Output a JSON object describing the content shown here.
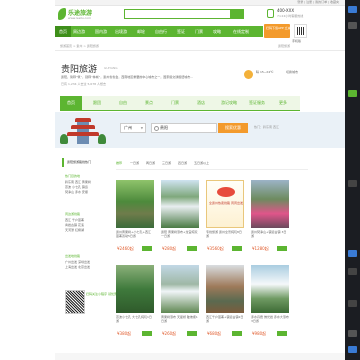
{
  "topbar": {
    "links": "登录 | 注册 | 我的订单 | 收藏夹"
  },
  "header": {
    "logo_text": "乐途旅游",
    "logo_sub": "www.leetu.com",
    "phone": "400-XXX",
    "phone_sub": "7×24小时客服热线",
    "app_promo": "扫码下载APP 立减50元",
    "qr_label": "手机版"
  },
  "nav": {
    "items": [
      {
        "label": "首页"
      },
      {
        "label": "周边游"
      },
      {
        "label": "国内游"
      },
      {
        "label": "出境游"
      },
      {
        "label": "邮轮"
      },
      {
        "label": "自由行"
      },
      {
        "label": "签证"
      },
      {
        "label": "门票"
      },
      {
        "label": "攻略"
      },
      {
        "label": "在线定制"
      }
    ]
  },
  "breadcrumb": "旅游首页 > 贵州 > 贵阳旅游",
  "breadcrumb_right": "贵阳旅游",
  "destination": {
    "title": "贵阳旅游",
    "pinyin": "GUIYANG",
    "description": "贵阳，简称“筑”，别称“林城”，贵州省省会，西南地区重要的中心城市之一，国家级交通枢纽城市...",
    "stats": "已有 1,234 人去过   5,678 人想去",
    "weather": "晴 15~24℃",
    "country": "切换城市"
  },
  "dtabs": [
    {
      "label": "首页"
    },
    {
      "label": "跟团"
    },
    {
      "label": "自由"
    },
    {
      "label": "景点"
    },
    {
      "label": "门票"
    },
    {
      "label": "酒店"
    },
    {
      "label": "游记攻略"
    },
    {
      "label": "签证服务"
    },
    {
      "label": "更多"
    }
  ],
  "search": {
    "from_value": "广州",
    "input_value": "贵阳",
    "button": "搜索优惠",
    "hot": "热门：黔东南  西江"
  },
  "left_panel": {
    "title": "贵阳旅游路线热门",
    "sections": [
      {
        "heading": "热门目的地",
        "lines": [
          "黔东南 西江 黄果树",
          "荔波 小七孔 镇远",
          "梵净山 赤水 安顺"
        ]
      },
      {
        "heading": "周边游线路",
        "lines": [
          "西江 千户苗寨",
          "青岩古镇 花溪",
          "天河潭 红枫湖"
        ]
      },
      {
        "heading": "出发地线路",
        "lines": [
          "广州出发 深圳出发",
          "上海出发 北京出发"
        ]
      }
    ],
    "qr_text": "扫码关注小程序\n领优惠立减50元"
  },
  "filters": [
    "推荐",
    "一日游",
    "两日游",
    "三日游",
    "四日游",
    "五日游以上"
  ],
  "cards": [
    {
      "caption": "贵州黄果树+小七孔+西江苗寨双动5日游",
      "price": "¥2460起"
    },
    {
      "caption": "贵阳 黄果树瀑布+龙宫纯玩一日游",
      "price": "¥280起"
    },
    {
      "caption": "专线旅游 贵州全景纯玩8日游",
      "price": "¥3560起"
    },
    {
      "caption": "贵州梵净山+镇远古镇 3日游",
      "price": "¥1280起"
    },
    {
      "caption": "荔波小七孔 大七孔纯玩1日游",
      "price": "¥380起"
    },
    {
      "caption": "黄果树瀑布 天星桥 陡坡塘1日游",
      "price": "¥260起"
    },
    {
      "caption": "西江千户苗寨+镇远古镇2日游",
      "price": "¥680起"
    },
    {
      "caption": "赤水丹霞 佛光岩 赤水大瀑布3日游",
      "price": "¥980起"
    }
  ],
  "badge_text": "全贵州热卖线路 周周出发"
}
